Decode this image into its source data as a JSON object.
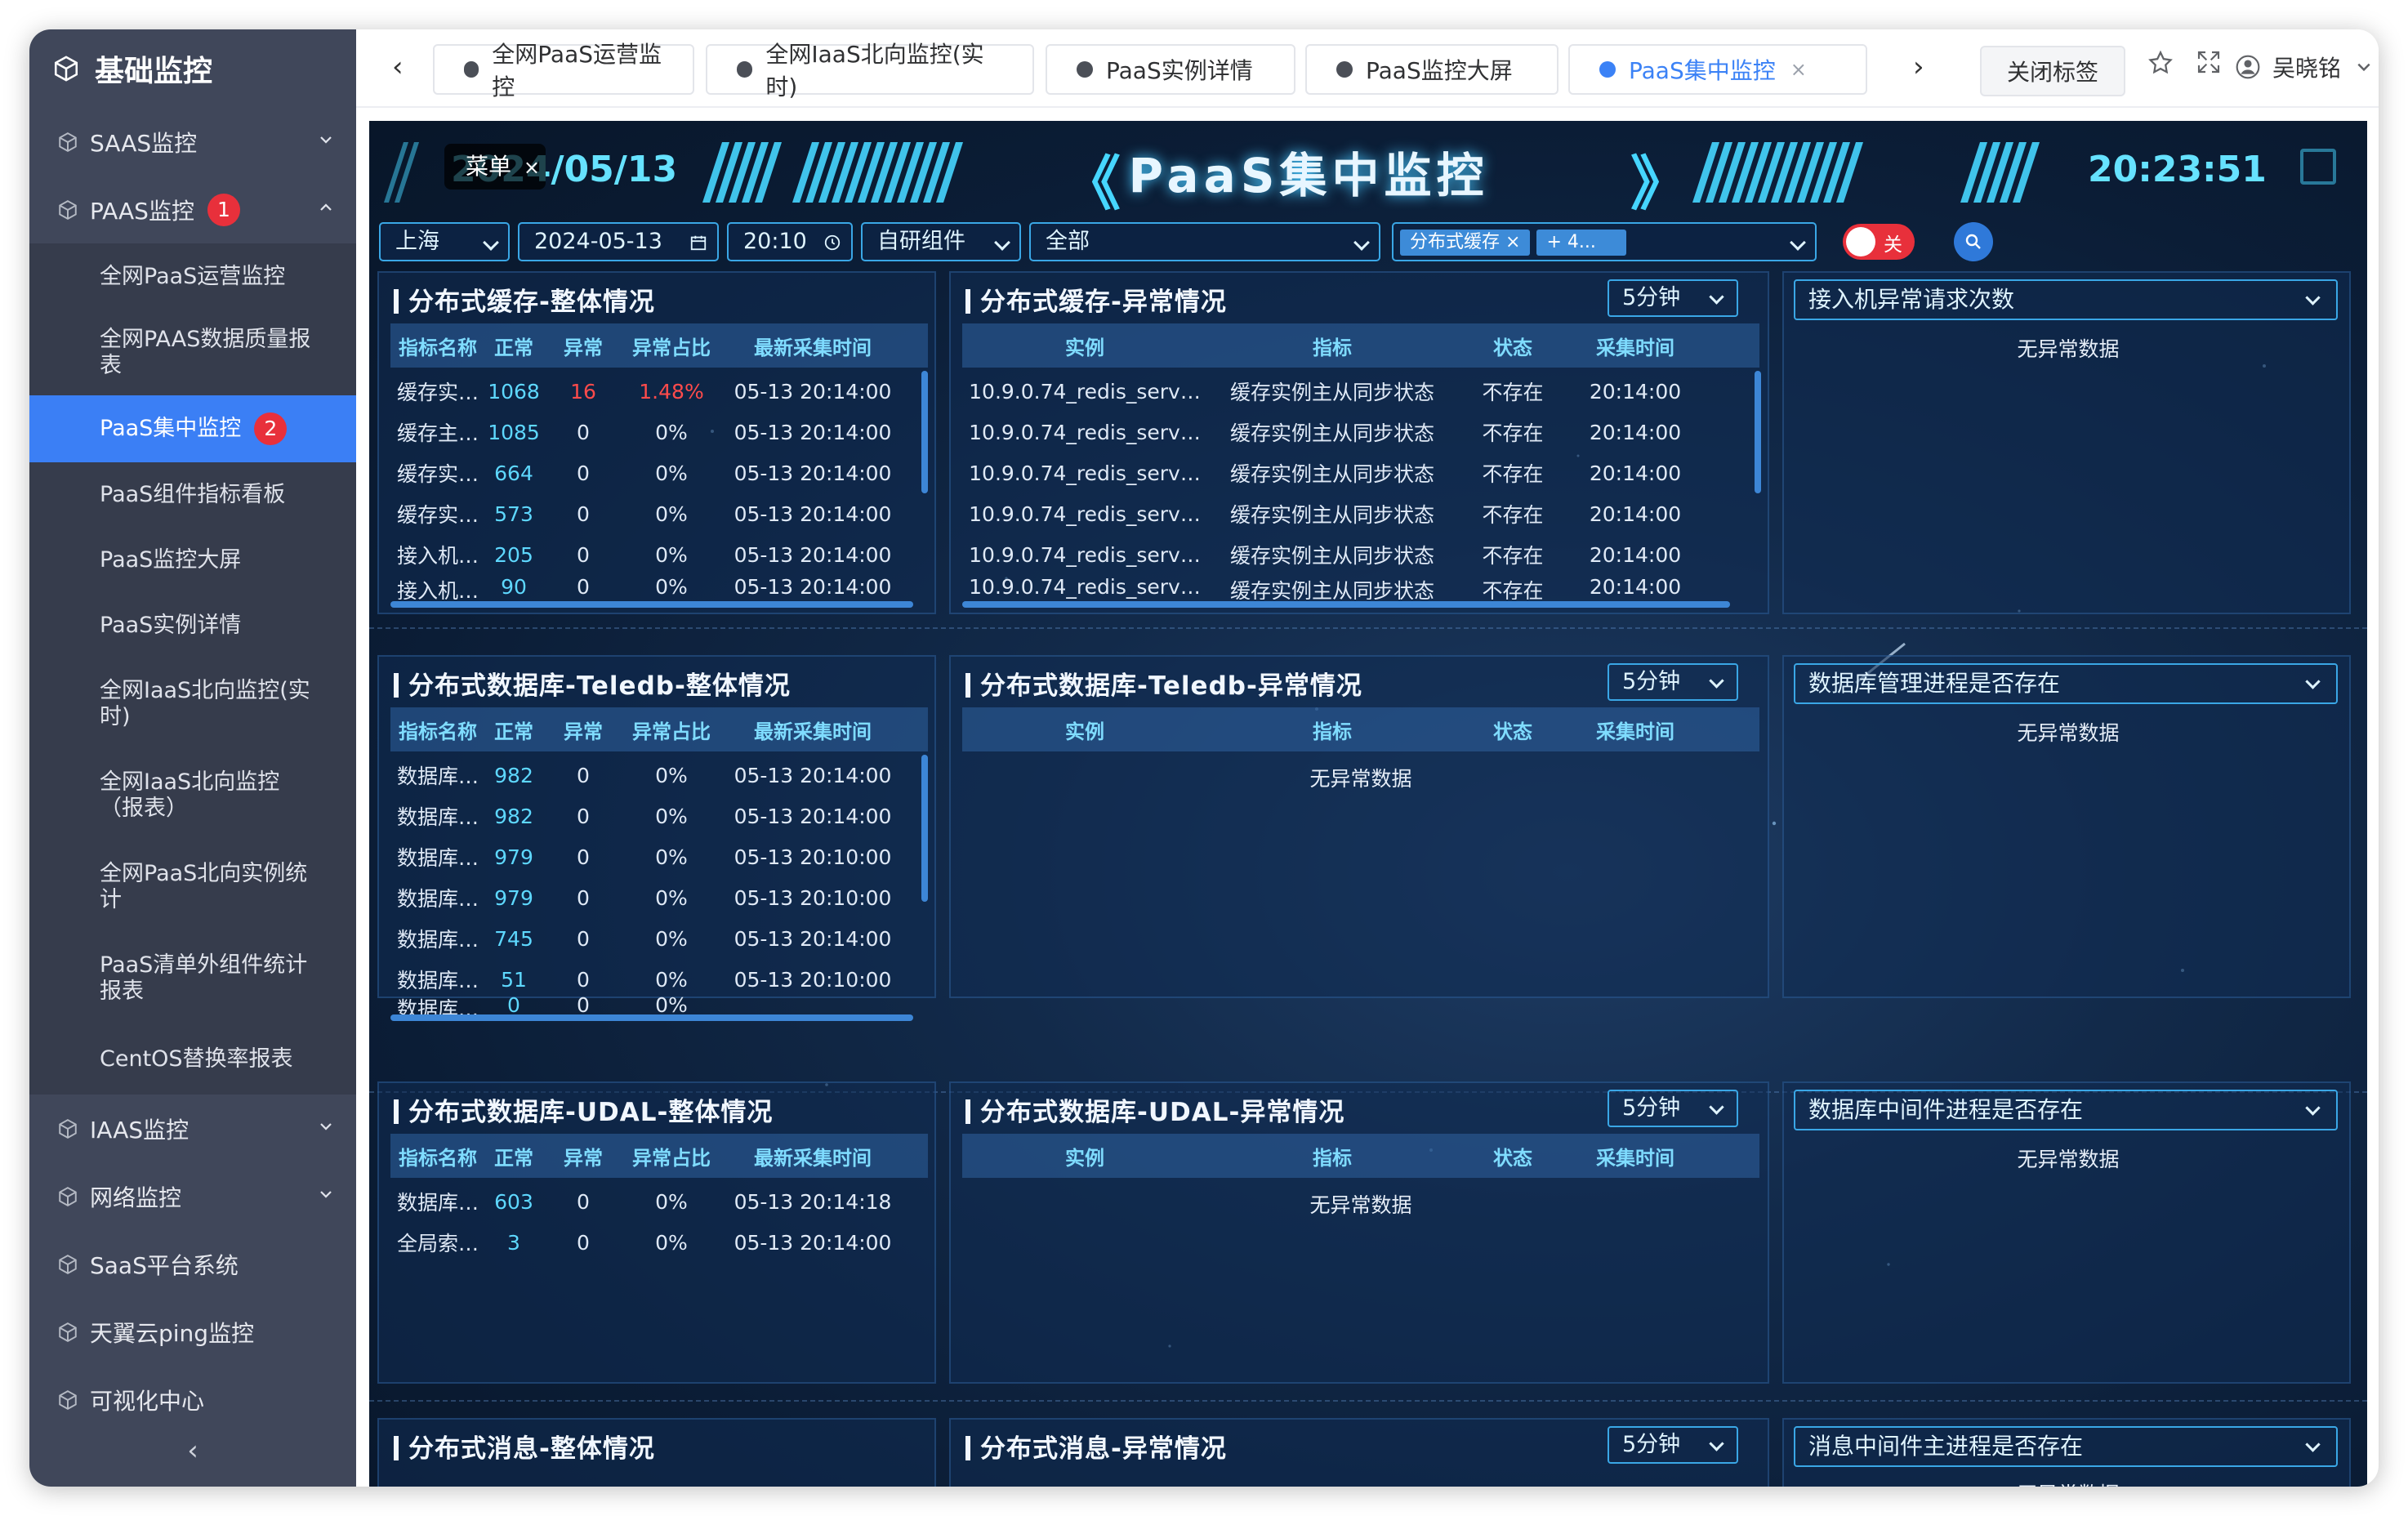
{
  "sidebar": {
    "title": "基础监控",
    "items": [
      {
        "label": "SAAS监控"
      },
      {
        "label": "PAAS监控",
        "badge": "1"
      },
      {
        "label": "IAAS监控"
      },
      {
        "label": "网络监控"
      },
      {
        "label": "SaaS平台系统"
      },
      {
        "label": "天翼云ping监控"
      },
      {
        "label": "可视化中心"
      }
    ],
    "paas_sub": [
      {
        "label": "全网PaaS运营监控"
      },
      {
        "label": "全网PAAS数据质量报表"
      },
      {
        "label": "PaaS集中监控",
        "badge": "2"
      },
      {
        "label": "PaaS组件指标看板"
      },
      {
        "label": "PaaS监控大屏"
      },
      {
        "label": "PaaS实例详情"
      },
      {
        "label": "全网IaaS北向监控(实时)"
      },
      {
        "label": "全网IaaS北向监控（报表）"
      },
      {
        "label": "全网PaaS北向实例统计"
      },
      {
        "label": "PaaS清单外组件统计报表"
      },
      {
        "label": "CentOS替换率报表"
      }
    ],
    "collapse": "‹"
  },
  "tabs": [
    {
      "label": "全网PaaS运营监控"
    },
    {
      "label": "全网IaaS北向监控(实时)"
    },
    {
      "label": "PaaS实例详情"
    },
    {
      "label": "PaaS监控大屏"
    },
    {
      "label": "PaaS集中监控",
      "close": "×"
    }
  ],
  "topbar": {
    "prev": "‹",
    "next": "›",
    "close_tags": "关闭标签",
    "user": "吴晓铭"
  },
  "dash": {
    "date": "2024/05/13",
    "menu": "菜单",
    "menu_close": "×",
    "title": "PaaS集中监控",
    "time": "20:23:51",
    "left_bracket": "《",
    "right_bracket": "》"
  },
  "filters": {
    "region": "上海",
    "date": "2024-05-13",
    "time": "20:10",
    "component_type": "自研组件",
    "scope": "全部",
    "component_tag": "分布式缓存",
    "more_tag": "+ 4...",
    "toggle": "关"
  },
  "headers": {
    "overview": [
      "指标名称",
      "正常",
      "异常",
      "异常占比",
      "最新采集时间"
    ],
    "abnormal": [
      "实例",
      "指标",
      "状态",
      "采集时间"
    ]
  },
  "empty_text": "无异常数据",
  "sections": [
    {
      "overview_title": "分布式缓存-整体情况",
      "abnormal_title": "分布式缓存-异常情况",
      "period": "5分钟",
      "right_select": "接入机异常请求次数",
      "overview_rows": [
        [
          "缓存实…",
          "1068",
          "16",
          "1.48%",
          "05-13 20:14:00"
        ],
        [
          "缓存主…",
          "1085",
          "0",
          "0%",
          "05-13 20:14:00"
        ],
        [
          "缓存实…",
          "664",
          "0",
          "0%",
          "05-13 20:14:00"
        ],
        [
          "缓存实…",
          "573",
          "0",
          "0%",
          "05-13 20:14:00"
        ],
        [
          "接入机…",
          "205",
          "0",
          "0%",
          "05-13 20:14:00"
        ],
        [
          "接入机…",
          "90",
          "0",
          "0%",
          "05-13 20:14:00"
        ]
      ],
      "abnormal_rows": [
        [
          "10.9.0.74_redis_serv…",
          "缓存实例主从同步状态",
          "不存在",
          "20:14:00"
        ],
        [
          "10.9.0.74_redis_serv…",
          "缓存实例主从同步状态",
          "不存在",
          "20:14:00"
        ],
        [
          "10.9.0.74_redis_serv…",
          "缓存实例主从同步状态",
          "不存在",
          "20:14:00"
        ],
        [
          "10.9.0.74_redis_serv…",
          "缓存实例主从同步状态",
          "不存在",
          "20:14:00"
        ],
        [
          "10.9.0.74_redis_serv…",
          "缓存实例主从同步状态",
          "不存在",
          "20:14:00"
        ],
        [
          "10.9.0.74_redis_serv…",
          "缓存实例主从同步状态",
          "不存在",
          "20:14:00"
        ]
      ]
    },
    {
      "overview_title": "分布式数据库-Teledb-整体情况",
      "abnormal_title": "分布式数据库-Teledb-异常情况",
      "period": "5分钟",
      "right_select": "数据库管理进程是否存在",
      "overview_rows": [
        [
          "数据库…",
          "982",
          "0",
          "0%",
          "05-13 20:14:00"
        ],
        [
          "数据库…",
          "982",
          "0",
          "0%",
          "05-13 20:14:00"
        ],
        [
          "数据库…",
          "979",
          "0",
          "0%",
          "05-13 20:10:00"
        ],
        [
          "数据库…",
          "979",
          "0",
          "0%",
          "05-13 20:10:00"
        ],
        [
          "数据库…",
          "745",
          "0",
          "0%",
          "05-13 20:14:00"
        ],
        [
          "数据库…",
          "51",
          "0",
          "0%",
          "05-13 20:10:00"
        ],
        [
          "数据库…",
          "0",
          "0",
          "0%",
          ""
        ]
      ]
    },
    {
      "overview_title": "分布式数据库-UDAL-整体情况",
      "abnormal_title": "分布式数据库-UDAL-异常情况",
      "period": "5分钟",
      "right_select": "数据库中间件进程是否存在",
      "overview_rows": [
        [
          "数据库…",
          "603",
          "0",
          "0%",
          "05-13 20:14:18"
        ],
        [
          "全局索…",
          "3",
          "0",
          "0%",
          "05-13 20:14:00"
        ]
      ]
    },
    {
      "overview_title": "分布式消息-整体情况",
      "abnormal_title": "分布式消息-异常情况",
      "period": "5分钟",
      "right_select": "消息中间件主进程是否存在"
    }
  ],
  "colors": {
    "accent": "#3b7ff5",
    "cyan": "#46d6ff",
    "danger": "#e8303b",
    "dash_bg": "#0f2644",
    "sidebar_bg": "#40475a"
  },
  "icons": [
    "cube-icon",
    "chevron-down-icon",
    "chevron-up-icon",
    "star-icon",
    "fullscreen-icon",
    "user-icon",
    "search-icon",
    "calendar-icon",
    "clock-icon"
  ]
}
